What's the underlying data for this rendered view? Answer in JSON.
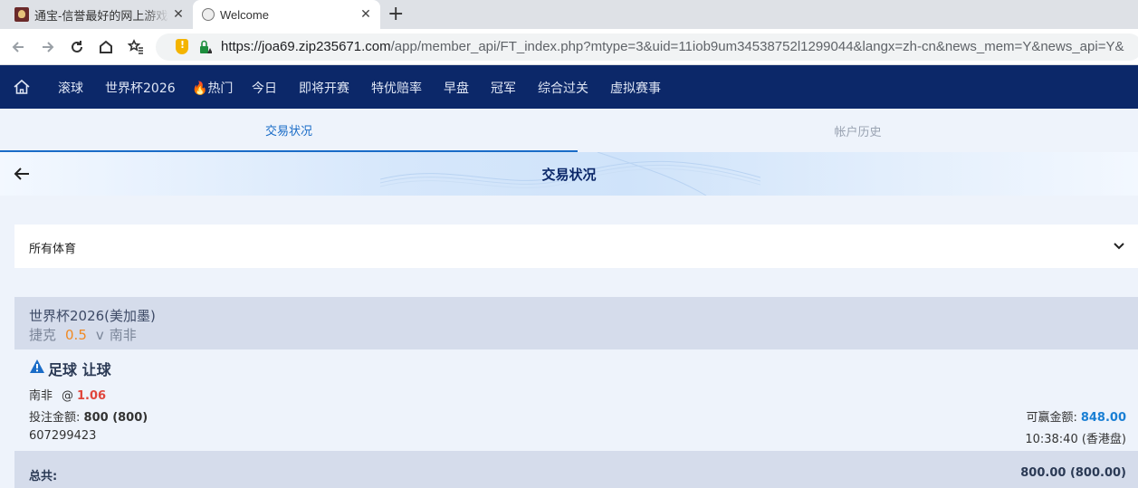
{
  "browser": {
    "tabs": [
      {
        "title": "通宝-信誉最好的网上游戏平",
        "close": "✕"
      },
      {
        "title": "Welcome",
        "close": "✕"
      }
    ],
    "new_tab": "+",
    "url_host": "https://joa69.zip235671.com",
    "url_rest": "/app/member_api/FT_index.php?mtype=3&uid=11iob9um34538752l1299044&langx=zh-cn&news_mem=Y&news_api=Y&"
  },
  "nav": {
    "items": [
      "滚球",
      "世界杯2026",
      "🔥热门",
      "今日",
      "即将开赛",
      "特优赔率",
      "早盘",
      "冠军",
      "综合过关",
      "虚拟赛事"
    ]
  },
  "tabs": {
    "active": "交易状况",
    "inactive": "帐户历史"
  },
  "banner": {
    "title": "交易状况"
  },
  "filter": {
    "label": "所有体育"
  },
  "bet": {
    "league": "世界杯2026(美加墨)",
    "home": "捷克",
    "handicap": "0.5",
    "vs": "v",
    "away": "南非",
    "type": "足球 让球",
    "selection": "南非",
    "at": "@",
    "odds": "1.06",
    "stake_label": "投注金额:",
    "stake_value": "800 (800)",
    "ticket": "607299423",
    "win_label": "可赢金额:",
    "win_value": "848.00",
    "time": "10:38:40 (香港盘)"
  },
  "total": {
    "label": "总共:",
    "value": "800.00 (800.00)"
  },
  "colors": {
    "nav_bg": "#0c2869",
    "accent": "#1a6cc7",
    "handicap": "#f08a24",
    "odds": "#e0463c",
    "win": "#1a7fd4"
  }
}
